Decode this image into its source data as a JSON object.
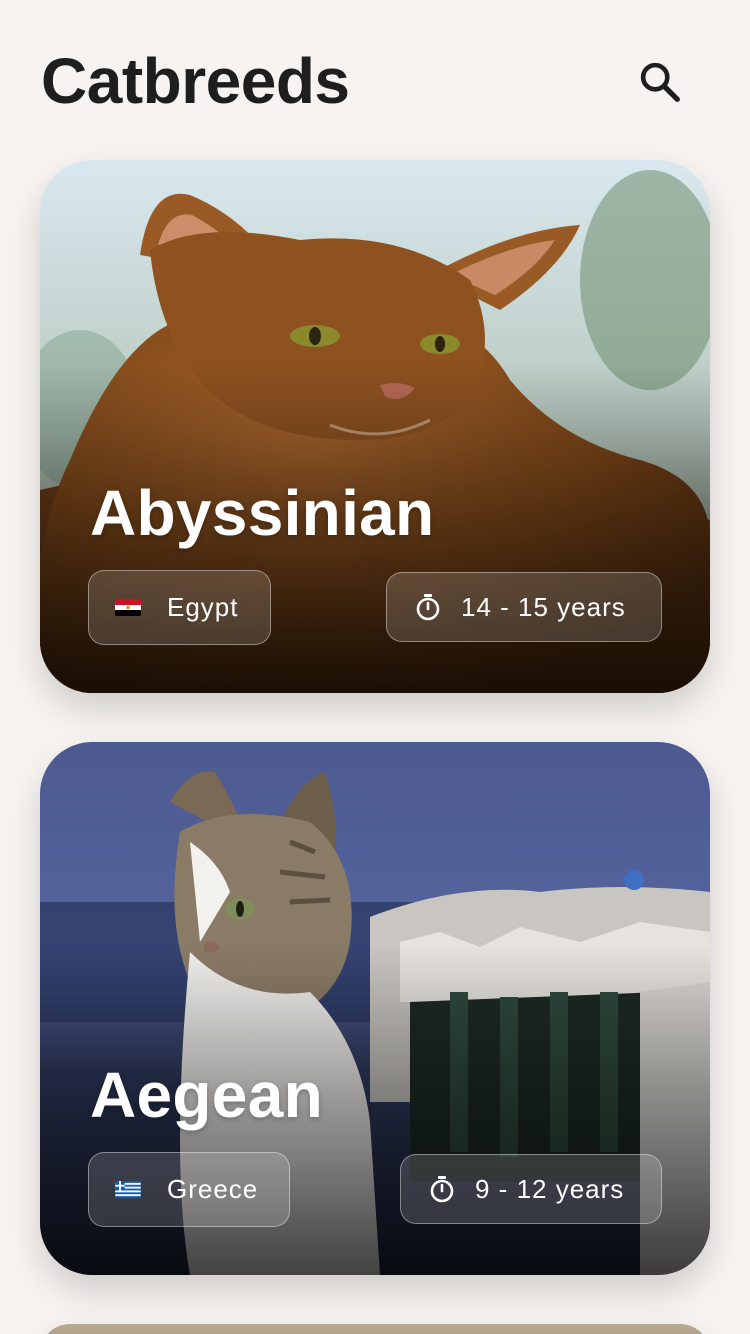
{
  "header": {
    "title": "Catbreeds",
    "search_icon": "search-icon"
  },
  "breeds": [
    {
      "name": "Abyssinian",
      "origin": "Egypt",
      "flag_icon": "egypt-flag-icon",
      "life_span": "14 - 15 years",
      "life_icon": "timer-icon"
    },
    {
      "name": "Aegean",
      "origin": "Greece",
      "flag_icon": "greece-flag-icon",
      "life_span": "9 - 12 years",
      "life_icon": "timer-icon"
    }
  ],
  "colors": {
    "background": "#f6f3f0",
    "title": "#1e1e1e",
    "card_text": "#ffffff"
  }
}
